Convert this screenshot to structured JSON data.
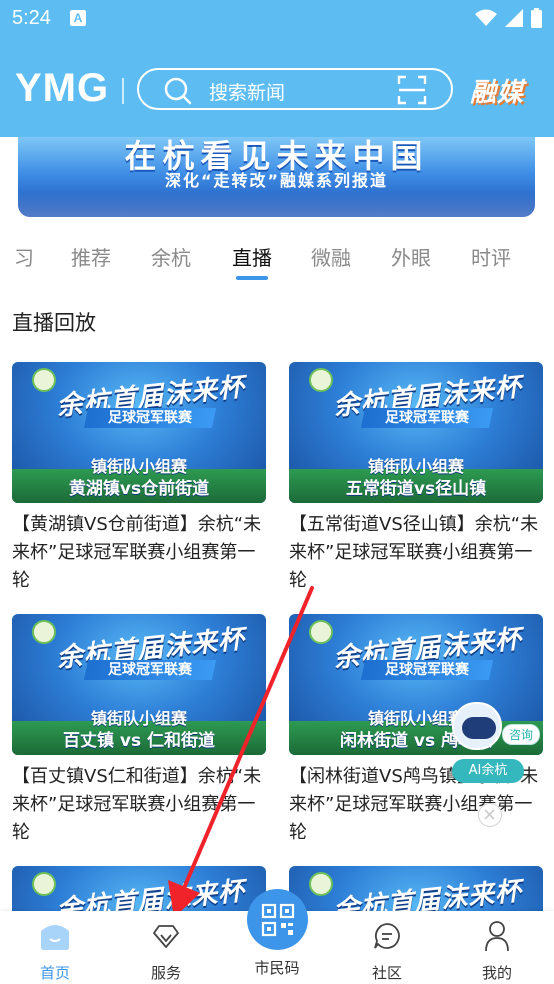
{
  "status_bar": {
    "time": "5:24",
    "notification_badge": "A",
    "icons": [
      "wifi-icon",
      "signal-icon",
      "battery-icon"
    ]
  },
  "header": {
    "logo": "YMG",
    "search": {
      "placeholder": "搜索新闻"
    },
    "brand": "融媒",
    "accent_color": "#5dbdf2"
  },
  "banner": {
    "headline": "在杭看见未来中国",
    "subline": "深化“走转改”融媒系列报道"
  },
  "tabs": [
    {
      "label": "习",
      "active": false
    },
    {
      "label": "推荐",
      "active": false
    },
    {
      "label": "余杭",
      "active": false
    },
    {
      "label": "直播",
      "active": true
    },
    {
      "label": "微融",
      "active": false
    },
    {
      "label": "外眼",
      "active": false
    },
    {
      "label": "时评",
      "active": false
    }
  ],
  "section_title": "直播回放",
  "cards": [
    {
      "thumb_title": "余杭首届沫来杯",
      "thumb_league": "足球冠军联赛",
      "thumb_group": "镇街队小组赛",
      "thumb_match": "黄湖镇vs仓前街道",
      "title": "【黄湖镇VS仓前街道】余杭“未来杯”足球冠军联赛小组赛第一轮"
    },
    {
      "thumb_title": "余杭首届沫来杯",
      "thumb_league": "足球冠军联赛",
      "thumb_group": "镇街队小组赛",
      "thumb_match": "五常街道vs径山镇",
      "title": "【五常街道VS径山镇】余杭“未来杯”足球冠军联赛小组赛第一轮"
    },
    {
      "thumb_title": "余杭首届沫来杯",
      "thumb_league": "足球冠军联赛",
      "thumb_group": "镇街队小组赛",
      "thumb_match": "百丈镇 vs 仁和街道",
      "title": "【百丈镇VS仁和街道】余杭“未来杯”足球冠军联赛小组赛第一轮"
    },
    {
      "thumb_title": "余杭首届沫来杯",
      "thumb_league": "足球冠军联赛",
      "thumb_group": "镇街队小组赛",
      "thumb_match": "闲林街道 vs 鸬鸟镇",
      "title": "【闲林街道VS鸬鸟镇】余杭“未来杯”足球冠军联赛小组赛第一轮"
    },
    {
      "thumb_title": "余杭首届沫来杯"
    },
    {
      "thumb_title": "余杭首届沫来杯"
    }
  ],
  "ai_widget": {
    "consult": "咨询",
    "label": "AI余杭"
  },
  "bottom_nav": [
    {
      "label": "首页",
      "icon": "home-icon",
      "active": true
    },
    {
      "label": "服务",
      "icon": "diamond-icon",
      "active": false
    },
    {
      "label": "市民码",
      "icon": "qr-code-icon",
      "active": false
    },
    {
      "label": "社区",
      "icon": "chat-bubble-icon",
      "active": false
    },
    {
      "label": "我的",
      "icon": "person-icon",
      "active": false
    }
  ]
}
